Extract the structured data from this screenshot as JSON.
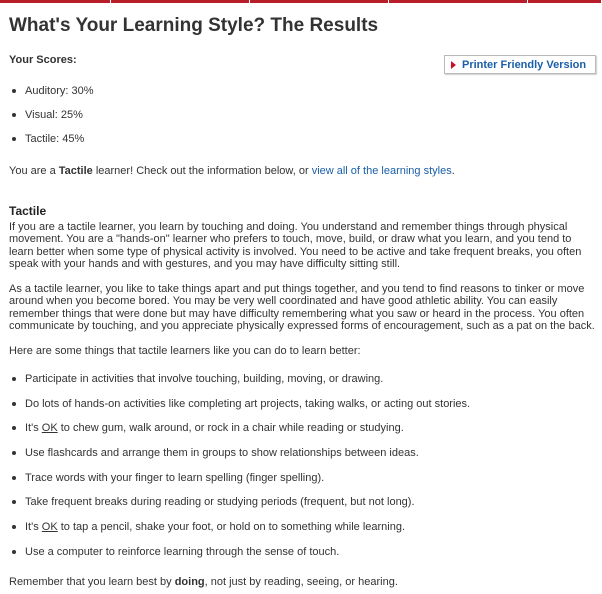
{
  "page": {
    "title": "What's Your Learning Style? The Results",
    "scores_heading": "Your Scores:",
    "printer_button": "Printer Friendly Version",
    "scores": [
      "Auditory: 30%",
      "Visual: 25%",
      "Tactile: 45%"
    ],
    "result": {
      "prefix": "You are a ",
      "style": "Tactile",
      "middle": " learner! Check out the information below, or ",
      "link": "view all of the learning styles",
      "suffix": "."
    },
    "section_heading": "Tactile",
    "paragraphs": [
      "If you are a tactile learner, you learn by touching and doing. You understand and remember things through physical movement. You are a \"hands-on\" learner who prefers to touch, move, build, or draw what you learn, and you tend to learn better when some type of physical activity is involved. You need to be active and take frequent breaks, you often speak with your hands and with gestures, and you may have difficulty sitting still.",
      "As a tactile learner, you like to take things apart and put things together, and you tend to find reasons to tinker or move around when you become bored. You may be very well coordinated and have good athletic ability. You can easily remember things that were done but may have difficulty remembering what you saw or heard in the process. You often communicate by touching, and you appreciate physically expressed forms of encouragement, such as a pat on the back.",
      "Here are some things that tactile learners like you can do to learn better:"
    ],
    "tips": [
      {
        "before": "Participate in activities that involve touching, building, moving, or drawing.",
        "ok": "",
        "after": ""
      },
      {
        "before": "Do lots of hands-on activities like completing art projects, taking walks, or acting out stories.",
        "ok": "",
        "after": ""
      },
      {
        "before": "It's ",
        "ok": "OK",
        "after": " to chew gum, walk around, or rock in a chair while reading or studying."
      },
      {
        "before": "Use flashcards and arrange them in groups to show relationships between ideas.",
        "ok": "",
        "after": ""
      },
      {
        "before": "Trace words with your finger to learn spelling (finger spelling).",
        "ok": "",
        "after": ""
      },
      {
        "before": "Take frequent breaks during reading or studying periods (frequent, but not long).",
        "ok": "",
        "after": ""
      },
      {
        "before": "It's ",
        "ok": "OK",
        "after": " to tap a pencil, shake your foot, or hold on to something while learning."
      },
      {
        "before": "Use a computer to reinforce learning through the sense of touch.",
        "ok": "",
        "after": ""
      }
    ],
    "closing": {
      "prefix": "Remember that you learn best by ",
      "bold": "doing",
      "suffix": ", not just by reading, seeing, or hearing."
    }
  },
  "colors": {
    "accent_red": "#b81d2a",
    "link_blue": "#1a5fa8",
    "text": "#333333"
  },
  "icons": {
    "printer_button_icon": "red-triangle-arrow-icon"
  }
}
